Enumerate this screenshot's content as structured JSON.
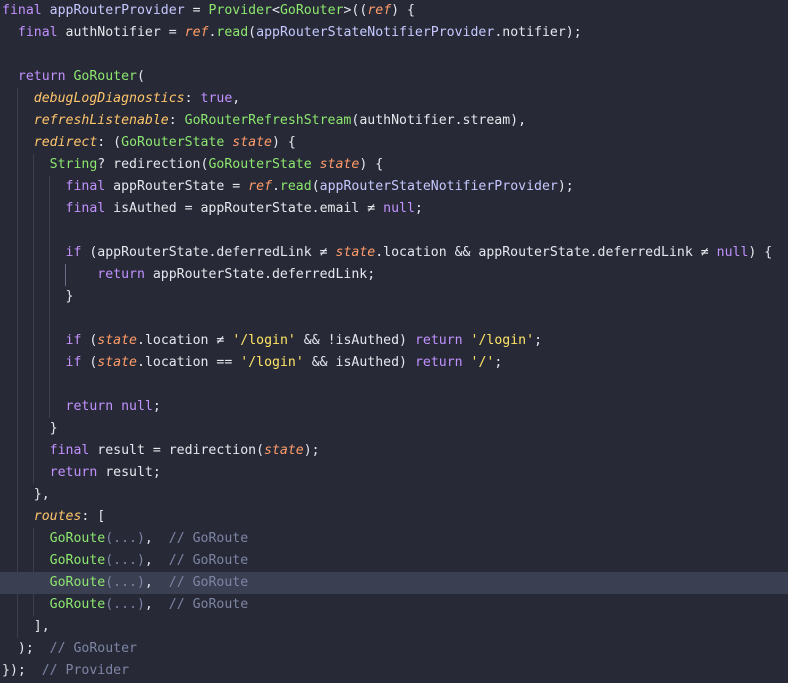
{
  "colors": {
    "background": "#272a36",
    "highlight_line": "#3b3f52",
    "keyword": "#c191ff",
    "type": "#8de76f",
    "string": "#ffe566",
    "parameter": "#ff9c6a",
    "named_argument": "#ffc56b",
    "comment": "#7e84a4",
    "text": "#e6e7ee"
  },
  "editor": {
    "highlighted_line": 26,
    "lines": [
      {
        "indent": 0,
        "guides": [],
        "tokens": [
          {
            "t": "final",
            "k": "kw"
          },
          {
            "t": " ",
            "k": "ws"
          },
          {
            "t": "appRouterProvider",
            "k": "fn"
          },
          {
            "t": " = ",
            "k": "op"
          },
          {
            "t": "Provider",
            "k": "type"
          },
          {
            "t": "<",
            "k": "punct"
          },
          {
            "t": "GoRouter",
            "k": "type"
          },
          {
            "t": ">((",
            "k": "punct"
          },
          {
            "t": "ref",
            "k": "param"
          },
          {
            "t": ") {",
            "k": "punct"
          }
        ]
      },
      {
        "indent": 0,
        "guides": [],
        "tokens": [
          {
            "t": "  final",
            "k": "kw"
          },
          {
            "t": " authNotifier = ",
            "k": "ident"
          },
          {
            "t": "ref",
            "k": "param"
          },
          {
            "t": ".",
            "k": "punct"
          },
          {
            "t": "read",
            "k": "type"
          },
          {
            "t": "(",
            "k": "punct"
          },
          {
            "t": "appRouterStateNotifierProvider",
            "k": "fn"
          },
          {
            "t": ".notifier);",
            "k": "ident"
          }
        ]
      },
      {
        "indent": 0,
        "guides": [],
        "tokens": []
      },
      {
        "indent": 0,
        "guides": [],
        "tokens": [
          {
            "t": "  return",
            "k": "kw"
          },
          {
            "t": " ",
            "k": "ws"
          },
          {
            "t": "GoRouter",
            "k": "type"
          },
          {
            "t": "(",
            "k": "punct"
          }
        ]
      },
      {
        "indent": 0,
        "guides": [
          1
        ],
        "tokens": [
          {
            "t": "    ",
            "k": "ws"
          },
          {
            "t": "debugLogDiagnostics",
            "k": "named"
          },
          {
            "t": ": ",
            "k": "punct"
          },
          {
            "t": "true",
            "k": "lit"
          },
          {
            "t": ",",
            "k": "punct"
          }
        ]
      },
      {
        "indent": 0,
        "guides": [
          1
        ],
        "tokens": [
          {
            "t": "    ",
            "k": "ws"
          },
          {
            "t": "refreshListenable",
            "k": "named"
          },
          {
            "t": ": ",
            "k": "punct"
          },
          {
            "t": "GoRouterRefreshStream",
            "k": "type"
          },
          {
            "t": "(authNotifier.stream),",
            "k": "ident"
          }
        ]
      },
      {
        "indent": 0,
        "guides": [
          1
        ],
        "tokens": [
          {
            "t": "    ",
            "k": "ws"
          },
          {
            "t": "redirect",
            "k": "named"
          },
          {
            "t": ": (",
            "k": "punct"
          },
          {
            "t": "GoRouterState",
            "k": "type"
          },
          {
            "t": " ",
            "k": "ws"
          },
          {
            "t": "state",
            "k": "param"
          },
          {
            "t": ") {",
            "k": "punct"
          }
        ]
      },
      {
        "indent": 0,
        "guides": [
          1,
          2
        ],
        "tokens": [
          {
            "t": "      ",
            "k": "ws"
          },
          {
            "t": "String",
            "k": "type"
          },
          {
            "t": "? redirection(",
            "k": "ident"
          },
          {
            "t": "GoRouterState",
            "k": "type"
          },
          {
            "t": " ",
            "k": "ws"
          },
          {
            "t": "state",
            "k": "param"
          },
          {
            "t": ") {",
            "k": "punct"
          }
        ]
      },
      {
        "indent": 0,
        "guides": [
          1,
          2,
          3
        ],
        "tokens": [
          {
            "t": "        final",
            "k": "kw"
          },
          {
            "t": " appRouterState = ",
            "k": "ident"
          },
          {
            "t": "ref",
            "k": "param"
          },
          {
            "t": ".",
            "k": "punct"
          },
          {
            "t": "read",
            "k": "type"
          },
          {
            "t": "(",
            "k": "punct"
          },
          {
            "t": "appRouterStateNotifierProvider",
            "k": "fn"
          },
          {
            "t": ");",
            "k": "punct"
          }
        ]
      },
      {
        "indent": 0,
        "guides": [
          1,
          2,
          3
        ],
        "tokens": [
          {
            "t": "        final",
            "k": "kw"
          },
          {
            "t": " isAuthed = appRouterState.email ",
            "k": "ident"
          },
          {
            "t": "≠",
            "k": "op"
          },
          {
            "t": " ",
            "k": "ws"
          },
          {
            "t": "null",
            "k": "lit"
          },
          {
            "t": ";",
            "k": "punct"
          }
        ]
      },
      {
        "indent": 0,
        "guides": [
          1,
          2,
          3
        ],
        "tokens": []
      },
      {
        "indent": 0,
        "guides": [
          1,
          2,
          3
        ],
        "tokens": [
          {
            "t": "        if",
            "k": "kw"
          },
          {
            "t": " (appRouterState.deferredLink ",
            "k": "ident"
          },
          {
            "t": "≠",
            "k": "op"
          },
          {
            "t": " ",
            "k": "ws"
          },
          {
            "t": "state",
            "k": "param"
          },
          {
            "t": ".location && appRouterState.deferredLink ",
            "k": "ident"
          },
          {
            "t": "≠",
            "k": "op"
          },
          {
            "t": " ",
            "k": "ws"
          },
          {
            "t": "null",
            "k": "lit"
          },
          {
            "t": ") {",
            "k": "punct"
          }
        ]
      },
      {
        "indent": 0,
        "guides": [
          1,
          2,
          3,
          4
        ],
        "tokens": [
          {
            "t": "            return",
            "k": "kw"
          },
          {
            "t": " appRouterState.deferredLink;",
            "k": "ident"
          }
        ]
      },
      {
        "indent": 0,
        "guides": [
          1,
          2,
          3
        ],
        "tokens": [
          {
            "t": "        }",
            "k": "punct"
          }
        ]
      },
      {
        "indent": 0,
        "guides": [
          1,
          2,
          3
        ],
        "tokens": []
      },
      {
        "indent": 0,
        "guides": [
          1,
          2,
          3
        ],
        "tokens": [
          {
            "t": "        if",
            "k": "kw"
          },
          {
            "t": " (",
            "k": "punct"
          },
          {
            "t": "state",
            "k": "param"
          },
          {
            "t": ".location ",
            "k": "ident"
          },
          {
            "t": "≠",
            "k": "op"
          },
          {
            "t": " ",
            "k": "ws"
          },
          {
            "t": "'/login'",
            "k": "str"
          },
          {
            "t": " && !isAuthed) ",
            "k": "ident"
          },
          {
            "t": "return",
            "k": "kw"
          },
          {
            "t": " ",
            "k": "ws"
          },
          {
            "t": "'/login'",
            "k": "str"
          },
          {
            "t": ";",
            "k": "punct"
          }
        ]
      },
      {
        "indent": 0,
        "guides": [
          1,
          2,
          3
        ],
        "tokens": [
          {
            "t": "        if",
            "k": "kw"
          },
          {
            "t": " (",
            "k": "punct"
          },
          {
            "t": "state",
            "k": "param"
          },
          {
            "t": ".location ",
            "k": "ident"
          },
          {
            "t": "==",
            "k": "op"
          },
          {
            "t": " ",
            "k": "ws"
          },
          {
            "t": "'/login'",
            "k": "str"
          },
          {
            "t": " && isAuthed) ",
            "k": "ident"
          },
          {
            "t": "return",
            "k": "kw"
          },
          {
            "t": " ",
            "k": "ws"
          },
          {
            "t": "'/'",
            "k": "str"
          },
          {
            "t": ";",
            "k": "punct"
          }
        ]
      },
      {
        "indent": 0,
        "guides": [
          1,
          2,
          3
        ],
        "tokens": []
      },
      {
        "indent": 0,
        "guides": [
          1,
          2,
          3
        ],
        "tokens": [
          {
            "t": "        return",
            "k": "kw"
          },
          {
            "t": " ",
            "k": "ws"
          },
          {
            "t": "null",
            "k": "lit"
          },
          {
            "t": ";",
            "k": "punct"
          }
        ]
      },
      {
        "indent": 0,
        "guides": [
          1,
          2
        ],
        "tokens": [
          {
            "t": "      }",
            "k": "punct"
          }
        ]
      },
      {
        "indent": 0,
        "guides": [
          1,
          2
        ],
        "tokens": [
          {
            "t": "      final",
            "k": "kw"
          },
          {
            "t": " result = redirection(",
            "k": "ident"
          },
          {
            "t": "state",
            "k": "param"
          },
          {
            "t": ");",
            "k": "punct"
          }
        ]
      },
      {
        "indent": 0,
        "guides": [
          1,
          2
        ],
        "tokens": [
          {
            "t": "      return",
            "k": "kw"
          },
          {
            "t": " result;",
            "k": "ident"
          }
        ]
      },
      {
        "indent": 0,
        "guides": [
          1
        ],
        "tokens": [
          {
            "t": "    },",
            "k": "punct"
          }
        ]
      },
      {
        "indent": 0,
        "guides": [
          1
        ],
        "tokens": [
          {
            "t": "    ",
            "k": "ws"
          },
          {
            "t": "routes",
            "k": "named"
          },
          {
            "t": ": [",
            "k": "punct"
          }
        ]
      },
      {
        "indent": 0,
        "guides": [
          1,
          2
        ],
        "tokens": [
          {
            "t": "      ",
            "k": "ws"
          },
          {
            "t": "GoRoute",
            "k": "type"
          },
          {
            "t": "(...)",
            "k": "fold"
          },
          {
            "t": ",  ",
            "k": "punct"
          },
          {
            "t": "// GoRoute",
            "k": "comment"
          }
        ]
      },
      {
        "indent": 0,
        "guides": [
          1,
          2
        ],
        "tokens": [
          {
            "t": "      ",
            "k": "ws"
          },
          {
            "t": "GoRoute",
            "k": "type"
          },
          {
            "t": "(...)",
            "k": "fold"
          },
          {
            "t": ",  ",
            "k": "punct"
          },
          {
            "t": "// GoRoute",
            "k": "comment"
          }
        ]
      },
      {
        "indent": 0,
        "guides": [
          1,
          2
        ],
        "tokens": [
          {
            "t": "      ",
            "k": "ws"
          },
          {
            "t": "GoRoute",
            "k": "type"
          },
          {
            "t": "(...)",
            "k": "fold"
          },
          {
            "t": ",  ",
            "k": "punct"
          },
          {
            "t": "// GoRoute",
            "k": "comment"
          }
        ]
      },
      {
        "indent": 0,
        "guides": [
          1,
          2
        ],
        "tokens": [
          {
            "t": "      ",
            "k": "ws"
          },
          {
            "t": "GoRoute",
            "k": "type"
          },
          {
            "t": "(...)",
            "k": "fold"
          },
          {
            "t": ",  ",
            "k": "punct"
          },
          {
            "t": "// GoRoute",
            "k": "comment"
          }
        ]
      },
      {
        "indent": 0,
        "guides": [
          1
        ],
        "tokens": [
          {
            "t": "    ],",
            "k": "punct"
          }
        ]
      },
      {
        "indent": 0,
        "guides": [],
        "tokens": [
          {
            "t": "  );",
            "k": "punct"
          },
          {
            "t": "  ",
            "k": "ws"
          },
          {
            "t": "// GoRouter",
            "k": "comment"
          }
        ]
      },
      {
        "indent": 0,
        "guides": [],
        "tokens": [
          {
            "t": "});",
            "k": "punct"
          },
          {
            "t": "  ",
            "k": "ws"
          },
          {
            "t": "// Provider",
            "k": "comment"
          }
        ]
      }
    ]
  }
}
